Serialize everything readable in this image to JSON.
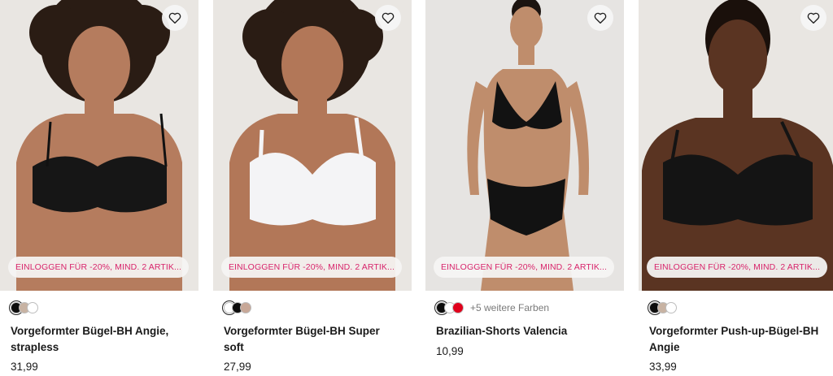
{
  "products": [
    {
      "title": "Vorgeformter Bügel-BH Angie, strapless",
      "price": "31,99",
      "promo": "EINLOGGEN FÜR -20%, MIND. 2 ARTIK...",
      "swatches": [
        "#0d0d0d",
        "#c8b3a3",
        "#ffffff"
      ],
      "more_colors": "",
      "skin": "#b57c5e",
      "garment": "#161616"
    },
    {
      "title": "Vorgeformter Bügel-BH Super soft",
      "price": "27,99",
      "promo": "EINLOGGEN FÜR -20%, MIND. 2 ARTIK...",
      "swatches": [
        "#ffffff",
        "#0d0d0d",
        "#c8a898"
      ],
      "more_colors": "",
      "skin": "#b27758",
      "garment": "#f4f4f6"
    },
    {
      "title": "Brazilian-Shorts Valencia",
      "price": "10,99",
      "promo": "EINLOGGEN FÜR -20%, MIND. 2 ARTIK...",
      "swatches": [
        "#0d0d0d",
        "#ffffff",
        "#e0001b"
      ],
      "more_colors": "+5 weitere Farben",
      "skin": "#bf8d6c",
      "garment": "#121212"
    },
    {
      "title": "Vorgeformter Push-up-Bügel-BH Angie",
      "price": "33,99",
      "promo": "EINLOGGEN FÜR -20%, MIND. 2 ARTIK...",
      "swatches": [
        "#0d0d0d",
        "#c8b3a3",
        "#ffffff"
      ],
      "more_colors": "",
      "skin": "#5a3422",
      "garment": "#141414"
    }
  ],
  "colors": {
    "promo_text": "#d8246b",
    "price": "#1a1a1a",
    "more_colors": "#7a7a7a"
  },
  "icons": {
    "favorite": "heart-outline-icon"
  }
}
